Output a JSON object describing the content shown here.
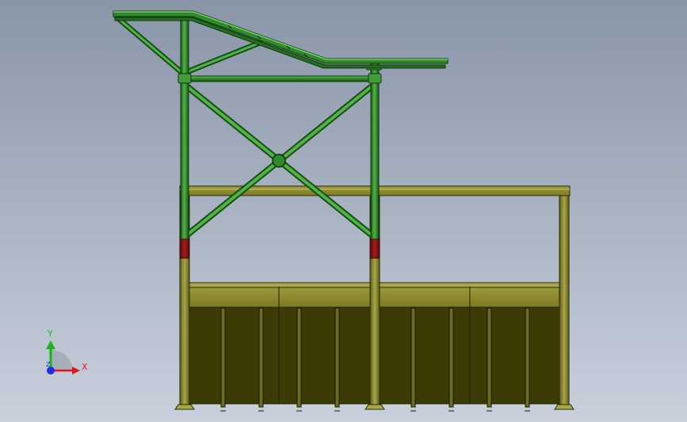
{
  "viewport": {
    "background_top": "#8996a8",
    "background_bottom": "#c9d0dc"
  },
  "colors": {
    "steel_green": "#2f8a2a",
    "steel_green_dark": "#1b5a18",
    "steel_green_light": "#5fc04f",
    "base_olive": "#8c8a2c",
    "base_olive_dark": "#3a3808",
    "base_olive_fill": "#3d3b05",
    "base_olive_light": "#a9a74a",
    "connector_red": "#8a1414"
  },
  "triad": {
    "x_label": "X",
    "y_label": "Y",
    "z_label": "Z",
    "x_color": "#e01515",
    "y_color": "#17b317",
    "z_color": "#1f2fe0"
  }
}
